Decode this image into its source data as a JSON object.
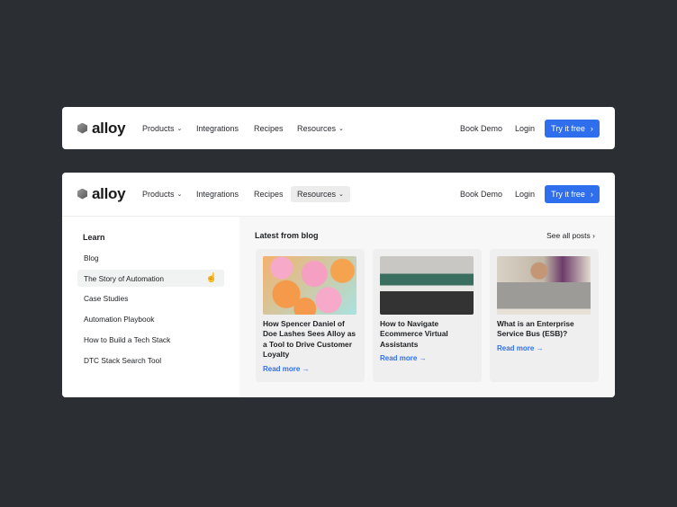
{
  "nav": {
    "logo": "alloy",
    "products": "Products",
    "integrations": "Integrations",
    "recipes": "Recipes",
    "resources": "Resources",
    "book_demo": "Book Demo",
    "login": "Login",
    "try_free": "Try it free",
    "chevron": "⌄",
    "arrow": "›"
  },
  "learn": {
    "heading": "Learn",
    "items": [
      "Blog",
      "The Story of Automation",
      "Case Studies",
      "Automation Playbook",
      "How to Build a Tech Stack",
      "DTC Stack Search Tool"
    ]
  },
  "blog": {
    "heading": "Latest from blog",
    "see_all": "See all posts ›",
    "read_more": "Read more →",
    "posts": [
      {
        "title": "How Spencer Daniel of Doe Lashes Sees Alloy as a Tool to Drive Customer Loyalty"
      },
      {
        "title": "How to Navigate Ecommerce Virtual Assistants"
      },
      {
        "title": "What is an Enterprise Service Bus (ESB)?"
      }
    ]
  },
  "colors": {
    "accent": "#2f6fed",
    "background": "#2b2e33"
  }
}
